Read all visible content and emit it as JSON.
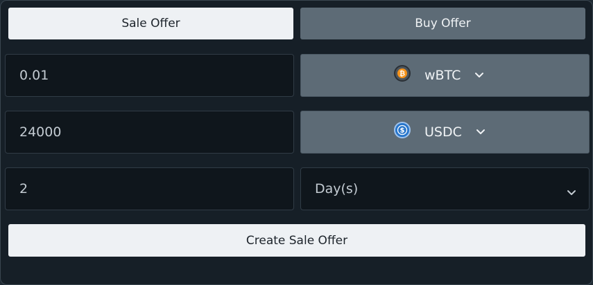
{
  "tabs": {
    "sale_label": "Sale Offer",
    "buy_label": "Buy Offer"
  },
  "amount": {
    "value": "0.01"
  },
  "sell_token": {
    "symbol": "wBTC",
    "icon": "bitcoin-icon"
  },
  "price": {
    "value": "24000"
  },
  "buy_token": {
    "symbol": "USDC",
    "icon": "usdc-icon"
  },
  "duration": {
    "value": "2",
    "unit_label": "Day(s)"
  },
  "submit": {
    "label": "Create Sale Offer"
  },
  "colors": {
    "panel_bg": "#161f27",
    "light_button": "#eef1f4",
    "gray_button": "#5d6b76",
    "bitcoin_orange": "#f7931a",
    "usdc_blue": "#2775ca"
  }
}
